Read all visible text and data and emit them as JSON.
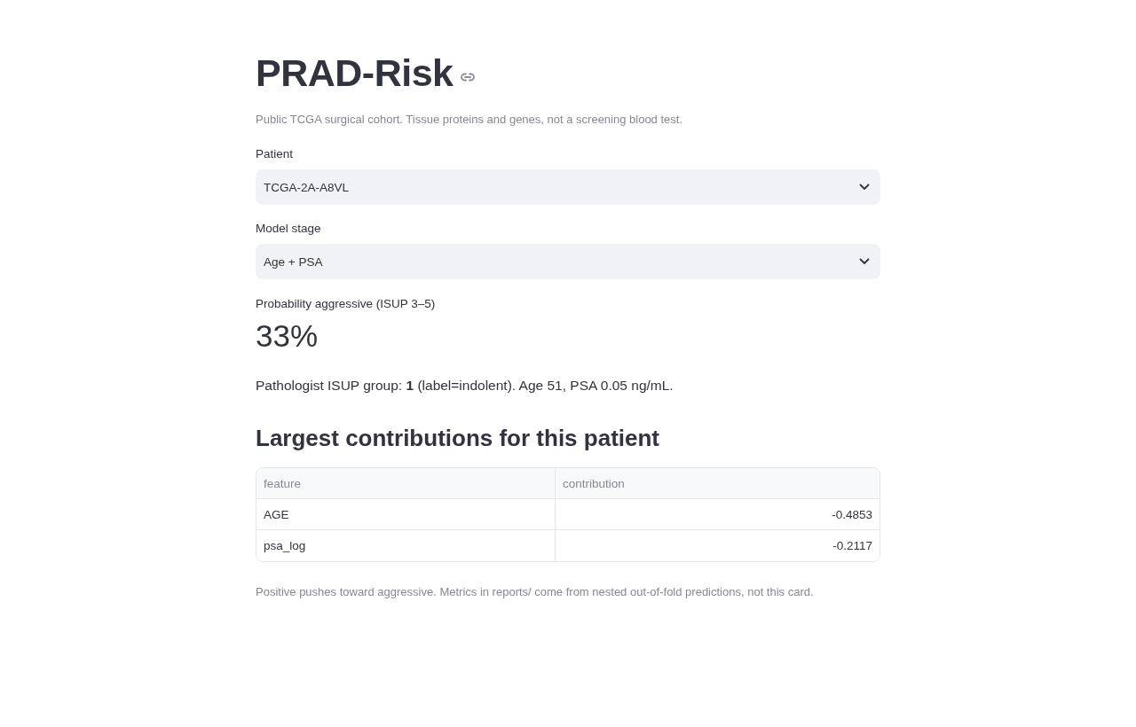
{
  "title": "PRAD-Risk",
  "caption": "Public TCGA surgical cohort. Tissue proteins and genes, not a screening blood test.",
  "selects": [
    {
      "label": "Patient",
      "value": "TCGA-2A-A8VL"
    },
    {
      "label": "Model stage",
      "value": "Age + PSA"
    }
  ],
  "metric": {
    "label": "Probability aggressive (ISUP 3–5)",
    "value": "33%"
  },
  "summary": "Pathologist ISUP group: **1** (label=indolent). Age 51, PSA 0.05 ng/mL.",
  "contributions": {
    "heading": "Largest contributions for this patient",
    "table": {
      "columns": [
        "feature",
        "contribution"
      ],
      "rows": [
        [
          "AGE",
          "-0.4853"
        ],
        [
          "psa_log",
          "-0.2117"
        ]
      ]
    }
  },
  "footnote": "Positive pushes toward aggressive. Metrics in reports/ come from nested out-of-fold predictions, not this card."
}
